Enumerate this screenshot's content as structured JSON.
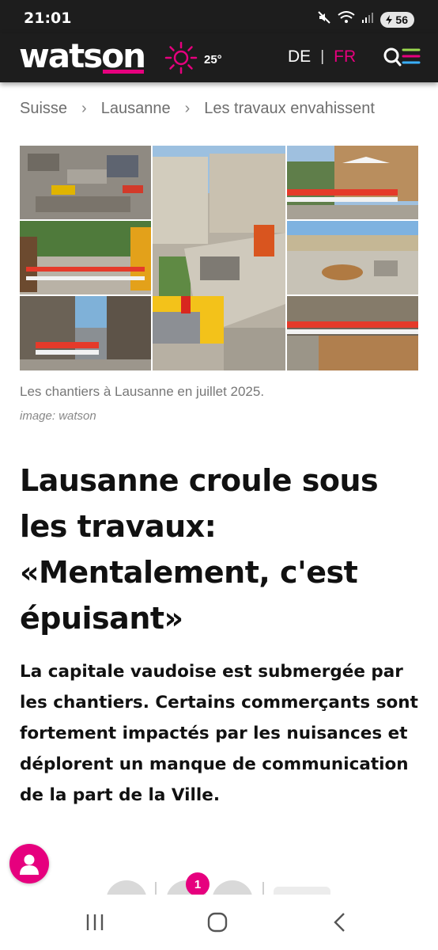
{
  "status_bar": {
    "time": "21:01",
    "battery_level": "56",
    "icons": [
      "mute-icon",
      "wifi-icon",
      "signal-icon",
      "battery-icon"
    ]
  },
  "header": {
    "logo": "watson",
    "weather": {
      "temperature": "25°",
      "icon": "sun-icon"
    },
    "languages": [
      "DE",
      "FR"
    ],
    "language_separator": "|",
    "active_language": "FR",
    "icons": [
      "search-icon",
      "menu-icon"
    ]
  },
  "breadcrumb": [
    "Suisse",
    "Lausanne",
    "Les travaux envahissent"
  ],
  "breadcrumb_separator": "›",
  "hero": {
    "caption": "Les chantiers à Lausanne en juillet 2025.",
    "credit": "image: watson"
  },
  "article": {
    "headline": "Lausanne croule sous les travaux: «Mentalement, c'est épuisant»",
    "lead": "La capitale vaudoise est submergée par les chantiers. Certains commer­çants sont fortement impactés par les nuisances et déplorent un manque de communication de la part de la Ville."
  },
  "reactions": {
    "badge_count": "1"
  },
  "colors": {
    "brand": "#e6007e",
    "header_bg": "#1d1d1d",
    "text": "#111111",
    "muted": "#777777"
  },
  "nav_bar": {
    "icons": [
      "recent-apps-icon",
      "home-icon",
      "back-icon"
    ]
  }
}
